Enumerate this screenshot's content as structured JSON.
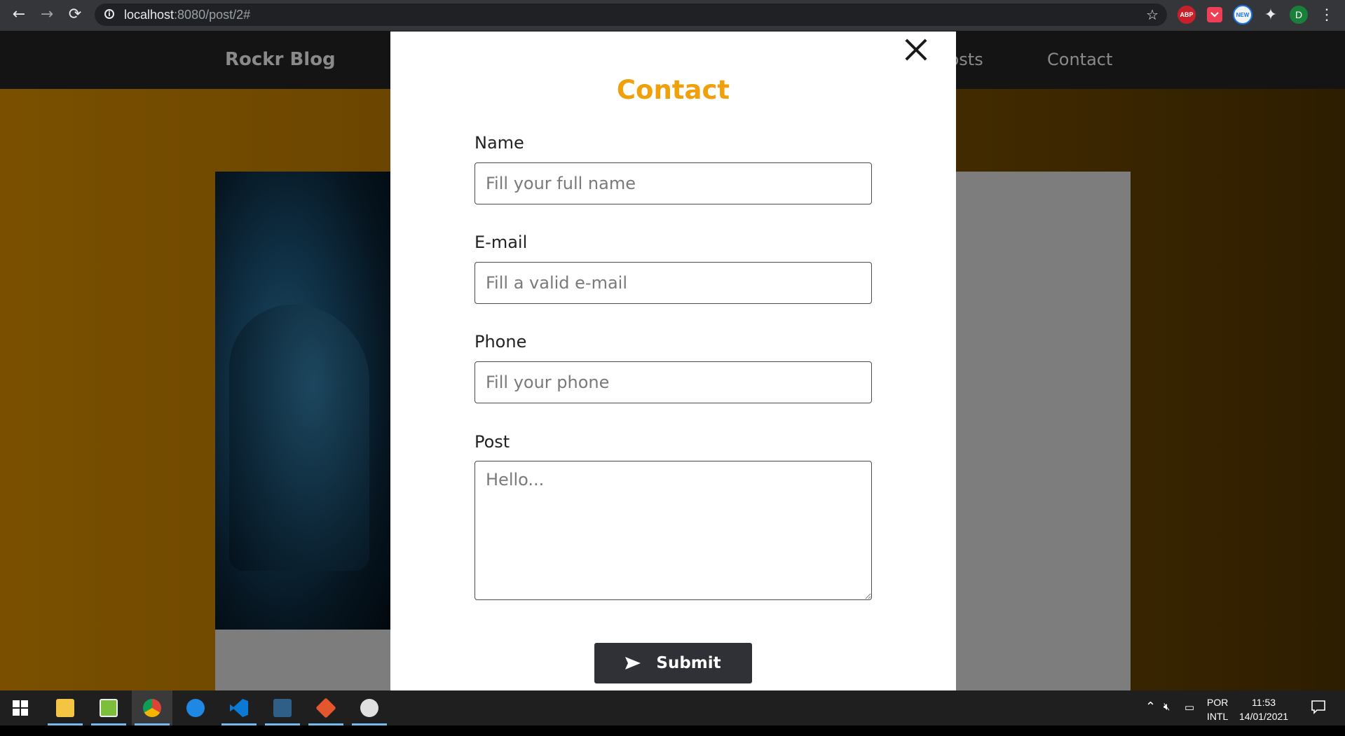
{
  "browser": {
    "url_host": "localhost",
    "url_rest": ":8080/post/2#",
    "back_icon": "←",
    "forward_icon": "→",
    "reload_icon": "⟳",
    "star_icon": "☆",
    "abp_label": "ABP",
    "new_badge": "NEW",
    "profile_initial": "D",
    "menu_icon": "⋮",
    "puzzle_icon": "✦"
  },
  "site": {
    "brand": "Rockr Blog",
    "nav": {
      "posts": "Posts",
      "contact": "Contact"
    }
  },
  "modal": {
    "title": "Contact",
    "fields": {
      "name": {
        "label": "Name",
        "placeholder": "Fill your full name"
      },
      "email": {
        "label": "E-mail",
        "placeholder": "Fill a valid e-mail"
      },
      "phone": {
        "label": "Phone",
        "placeholder": "Fill your phone"
      },
      "post": {
        "label": "Post",
        "placeholder": "Hello..."
      }
    },
    "submit_label": "Submit"
  },
  "taskbar": {
    "lang_top": "POR",
    "lang_bottom": "INTL",
    "time": "11:53",
    "date": "14/01/2021"
  },
  "colors": {
    "accent": "#f0a00a",
    "button": "#2f3136",
    "header_bg": "#141414"
  }
}
